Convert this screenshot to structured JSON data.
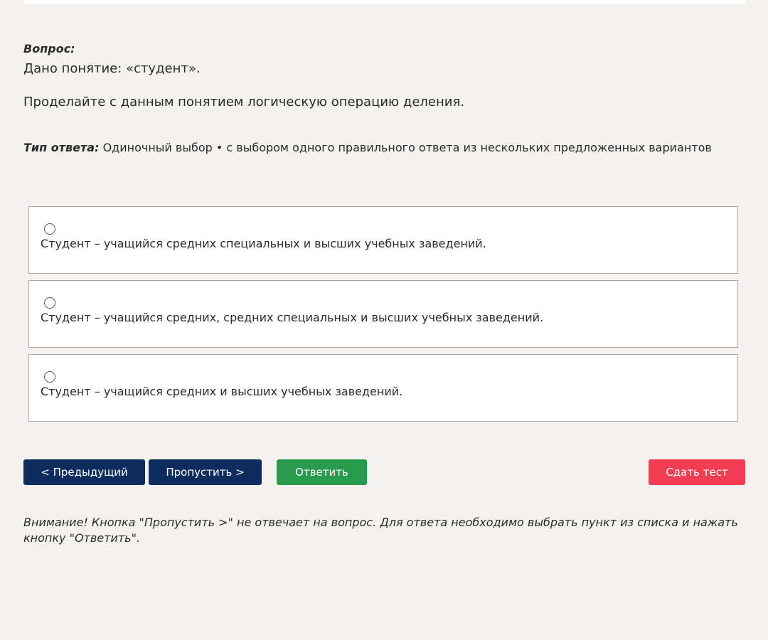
{
  "question": {
    "label": "Вопрос:",
    "line1": "Дано понятие: «студент».",
    "line2": "Проделайте с данным понятием логическую операцию деления."
  },
  "answer_type": {
    "label": "Тип ответа:",
    "value": "Одиночный выбор • с выбором одного правильного ответа из нескольких предложенных вариантов"
  },
  "options": [
    {
      "text": "Студент – учащийся средних специальных и высших учебных заведений.",
      "selected": false
    },
    {
      "text": "Студент – учащийся средних, средних специальных и высших учебных заведений.",
      "selected": false
    },
    {
      "text": "Студент – учащийся средних и высших учебных заведений.",
      "selected": false
    }
  ],
  "buttons": {
    "prev": "< Предыдущий",
    "skip": "Пропустить >",
    "answer": "Ответить",
    "submit": "Сдать тест"
  },
  "notice": "Внимание! Кнопка \"Пропустить >\" не отвечает на вопрос. Для ответа необходимо выбрать пункт из списка и нажать кнопку \"Ответить\".",
  "colors": {
    "background": "#f3f2ef",
    "nav_button": "#0d2d5e",
    "answer_button": "#279a4e",
    "submit_button": "#f23d52"
  }
}
